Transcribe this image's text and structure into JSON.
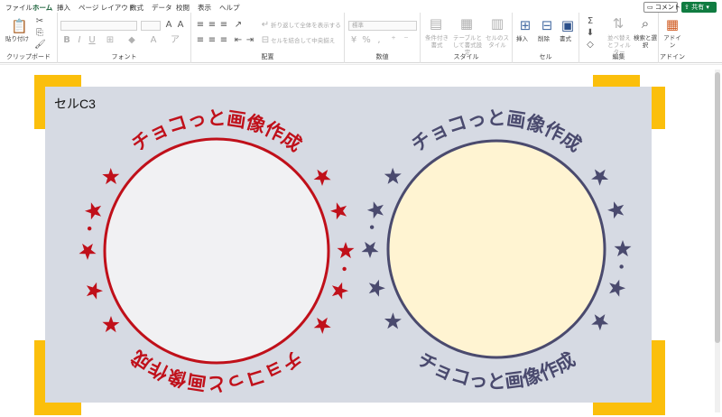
{
  "tabs": [
    "ファイル",
    "ホーム",
    "挿入",
    "ページ レイアウト",
    "数式",
    "データ",
    "校閲",
    "表示",
    "ヘルプ"
  ],
  "active_tab": "ホーム",
  "comment_label": "コメント",
  "share_label": "共有",
  "ribbon": {
    "paste_label": "貼り付け",
    "clipboard_group": "クリップボード",
    "font_group": "フォント",
    "alignment_group": "配置",
    "number_group": "数値",
    "style_group": "スタイル",
    "cells_group": "セル",
    "editing_group": "編集",
    "addins_group": "アドイン",
    "wrap_text": "折り返して全体を表示する",
    "merge_center": "セルを結合して中央揃え",
    "number_format": "標準",
    "conditional_format": "条件付き書式",
    "format_as_table": "テーブルとして書式設定",
    "cell_styles": "セルのスタイル",
    "insert_label": "挿入",
    "delete_label": "削除",
    "format_label": "書式",
    "sort_filter": "並べ替えとフィルター",
    "find_select": "検索と選択",
    "addins_label": "アドイン"
  },
  "cell_label": "セルC3",
  "stamps": [
    {
      "text": "チョコっと画像作成",
      "color": "#c0101a",
      "fill": "#f1f1f3",
      "bottom_mirrored": true
    },
    {
      "text": "チョコっと画像作成",
      "color": "#4a4a6e",
      "fill": "#fff4d2",
      "bottom_mirrored": false
    }
  ],
  "colors": {
    "accent": "#107c41",
    "frame": "#fbbf0c",
    "canvas": "#d6dae3"
  }
}
